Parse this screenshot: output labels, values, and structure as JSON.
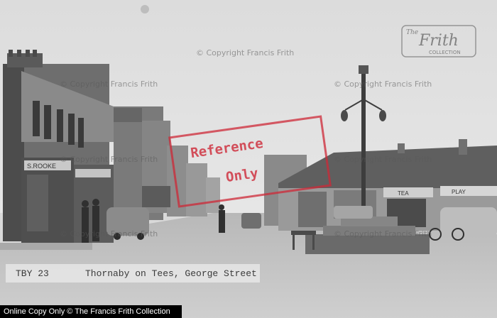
{
  "caption": {
    "ref": "TBY 23",
    "title": "Thornaby on Tees, George Street"
  },
  "watermarks": {
    "copyright": "© Copyright Francis Frith",
    "stamp_line1": "Reference",
    "stamp_line2": "Only",
    "logo_line1": "Frith",
    "logo_line2": "COLLECTION",
    "logo_prefix": "The"
  },
  "footer": {
    "text": "Online Copy Only © The Francis Frith Collection"
  },
  "shop_signs": {
    "left_1": "S.ROOKE",
    "right_1": "TEA",
    "right_2": "PLAY"
  },
  "colors": {
    "stamp": "#cd2837",
    "footer_bg": "#000000"
  }
}
